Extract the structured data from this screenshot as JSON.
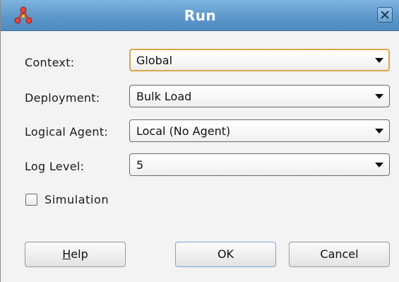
{
  "window": {
    "title": "Run",
    "app_icon": "odi-agent-icon",
    "close_icon": "close-icon"
  },
  "form": {
    "context": {
      "label": "Context:",
      "value": "Global"
    },
    "deployment": {
      "label": "Deployment:",
      "value": "Bulk Load"
    },
    "logical_agent": {
      "label": "Logical Agent:",
      "value": "Local (No Agent)"
    },
    "log_level": {
      "label": "Log Level:",
      "value": "5"
    }
  },
  "simulation": {
    "label": "Simulation",
    "checked": false
  },
  "buttons": {
    "help_mnemonic": "H",
    "help_rest": "elp",
    "ok": "OK",
    "cancel": "Cancel"
  },
  "colors": {
    "title_bar": "#5d98cb",
    "focus_border": "#d9a64a",
    "app_icon_red": "#d63a2f"
  }
}
